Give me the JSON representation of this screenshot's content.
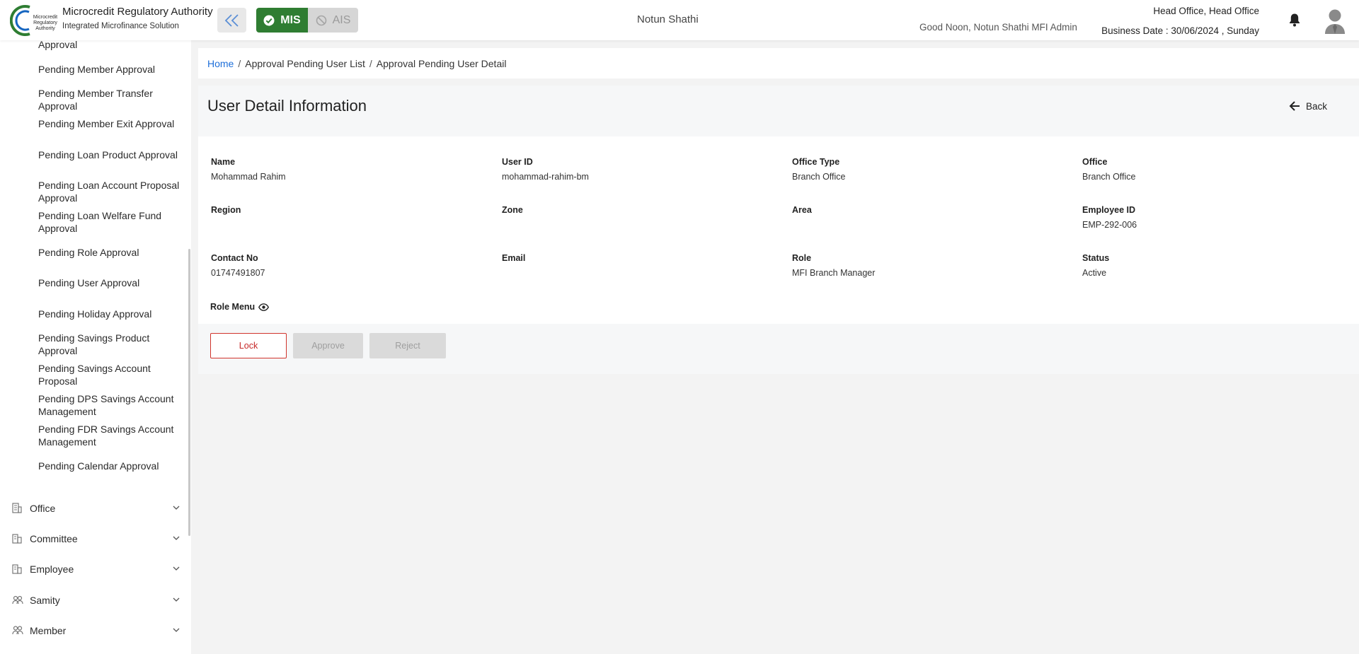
{
  "header": {
    "org_name": "Microcredit Regulatory Authority",
    "org_sub": "Integrated Microfinance Solution",
    "logo_text": "Microcredit Regulatory Authority",
    "mode_mis": "MIS",
    "mode_ais": "AIS",
    "center_title": "Notun Shathi",
    "greeting": "Good Noon, Notun Shathi MFI Admin",
    "office": "Head Office, Head Office",
    "business_date": "Business Date : 30/06/2024 , Sunday"
  },
  "sidebar": {
    "partial_item": "Approval",
    "items": [
      "Pending Member Approval",
      "Pending Member Transfer Approval",
      "Pending Member Exit Approval",
      "Pending Loan Product Approval",
      "Pending Loan Account Proposal Approval",
      "Pending Loan Welfare Fund Approval",
      "Pending Role Approval",
      "Pending User Approval",
      "Pending Holiday Approval",
      "Pending Savings Product Approval",
      "Pending Savings Account Proposal",
      "Pending DPS Savings Account Management",
      "Pending FDR Savings Account Management",
      "Pending Calendar Approval"
    ],
    "groups": [
      "Office",
      "Committee",
      "Employee",
      "Samity",
      "Member"
    ]
  },
  "breadcrumb": {
    "home": "Home",
    "list": "Approval Pending User List",
    "current": "Approval Pending User Detail",
    "sep": "/"
  },
  "detail": {
    "title": "User Detail Information",
    "back": "Back",
    "fields": [
      {
        "label": "Name",
        "value": "Mohammad Rahim"
      },
      {
        "label": "User ID",
        "value": "mohammad-rahim-bm"
      },
      {
        "label": "Office Type",
        "value": "Branch Office"
      },
      {
        "label": "Office",
        "value": "Branch Office"
      },
      {
        "label": "Region",
        "value": ""
      },
      {
        "label": "Zone",
        "value": ""
      },
      {
        "label": "Area",
        "value": ""
      },
      {
        "label": "Employee ID",
        "value": "EMP-292-006"
      },
      {
        "label": "Contact No",
        "value": "01747491807"
      },
      {
        "label": "Email",
        "value": ""
      },
      {
        "label": "Role",
        "value": "MFI Branch Manager"
      },
      {
        "label": "Status",
        "value": "Active"
      }
    ],
    "role_menu": "Role Menu",
    "buttons": {
      "lock": "Lock",
      "approve": "Approve",
      "reject": "Reject"
    }
  },
  "colors": {
    "mis_green": "#2f7d32",
    "link_blue": "#1e6fd9",
    "lock_red": "#c62828"
  }
}
